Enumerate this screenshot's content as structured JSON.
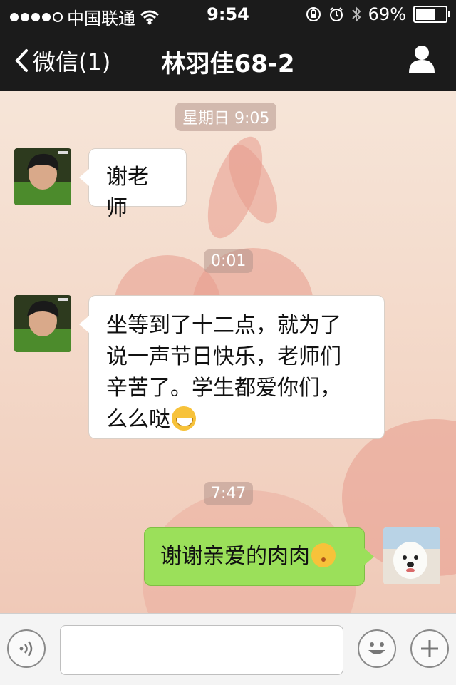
{
  "status_bar": {
    "carrier": "中国联通",
    "time": "9:54",
    "battery_percent": "69%",
    "battery_level": 0.69
  },
  "nav": {
    "back_label": "微信(1)",
    "title": "林羽佳68-2"
  },
  "messages": [
    {
      "type": "timestamp",
      "text": "星期日 9:05"
    },
    {
      "type": "incoming",
      "text": "谢老师"
    },
    {
      "type": "timestamp",
      "text": "0:01"
    },
    {
      "type": "incoming",
      "lines": [
        "坐等到了十二点，就为了",
        "说一声节日快乐，老师们",
        "辛苦了。学生都爱你们，",
        "么么哒"
      ],
      "emoji": "grinning-face-emoji"
    },
    {
      "type": "timestamp",
      "text": "7:47"
    },
    {
      "type": "outgoing",
      "text": "谢谢亲爱的肉肉",
      "emoji": "kissing-face-emoji"
    }
  ],
  "input": {
    "placeholder": ""
  },
  "colors": {
    "header_bg": "#1b1b1b",
    "outgoing_bubble": "#9be05a",
    "incoming_bubble": "#ffffff"
  }
}
